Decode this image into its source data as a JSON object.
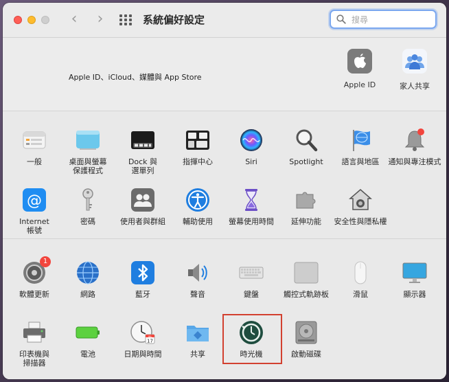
{
  "window": {
    "title": "系統偏好設定"
  },
  "search": {
    "placeholder": "搜尋"
  },
  "account": {
    "label": "Apple ID、iCloud、媒體與 App Store",
    "items": [
      {
        "label": "Apple ID",
        "icon": "apple-logo-icon"
      },
      {
        "label": "家人共享",
        "icon": "family-sharing-icon"
      }
    ]
  },
  "panes_row1": [
    {
      "label": "一般",
      "icon": "general-icon"
    },
    {
      "label": "桌面與螢幕\n保護程式",
      "icon": "desktop-screensaver-icon"
    },
    {
      "label": "Dock 與\n選單列",
      "icon": "dock-icon"
    },
    {
      "label": "指揮中心",
      "icon": "mission-control-icon"
    },
    {
      "label": "Siri",
      "icon": "siri-icon"
    },
    {
      "label": "Spotlight",
      "icon": "spotlight-icon"
    },
    {
      "label": "語言與地區",
      "icon": "language-region-icon"
    },
    {
      "label": "通知與專注模式",
      "icon": "notifications-icon"
    }
  ],
  "panes_row2": [
    {
      "label": "Internet\n帳號",
      "icon": "internet-accounts-icon"
    },
    {
      "label": "密碼",
      "icon": "key-icon"
    },
    {
      "label": "使用者與群組",
      "icon": "users-groups-icon"
    },
    {
      "label": "輔助使用",
      "icon": "accessibility-icon"
    },
    {
      "label": "螢幕使用時間",
      "icon": "screen-time-icon"
    },
    {
      "label": "延伸功能",
      "icon": "extensions-icon"
    },
    {
      "label": "安全性與隱私權",
      "icon": "security-privacy-icon"
    }
  ],
  "panes_row3": [
    {
      "label": "軟體更新",
      "icon": "software-update-icon",
      "badge": "1"
    },
    {
      "label": "網路",
      "icon": "network-icon"
    },
    {
      "label": "藍牙",
      "icon": "bluetooth-icon"
    },
    {
      "label": "聲音",
      "icon": "sound-icon"
    },
    {
      "label": "鍵盤",
      "icon": "keyboard-icon"
    },
    {
      "label": "觸控式軌跡板",
      "icon": "trackpad-icon"
    },
    {
      "label": "滑鼠",
      "icon": "mouse-icon"
    },
    {
      "label": "顯示器",
      "icon": "displays-icon"
    }
  ],
  "panes_row4": [
    {
      "label": "印表機與\n掃描器",
      "icon": "printer-icon"
    },
    {
      "label": "電池",
      "icon": "battery-icon"
    },
    {
      "label": "日期與時間",
      "icon": "clock-icon",
      "calendar_day": "17",
      "calendar_month": "JUL"
    },
    {
      "label": "共享",
      "icon": "sharing-folder-icon"
    },
    {
      "label": "時光機",
      "icon": "time-machine-icon"
    },
    {
      "label": "啟動磁碟",
      "icon": "startup-disk-icon"
    }
  ]
}
